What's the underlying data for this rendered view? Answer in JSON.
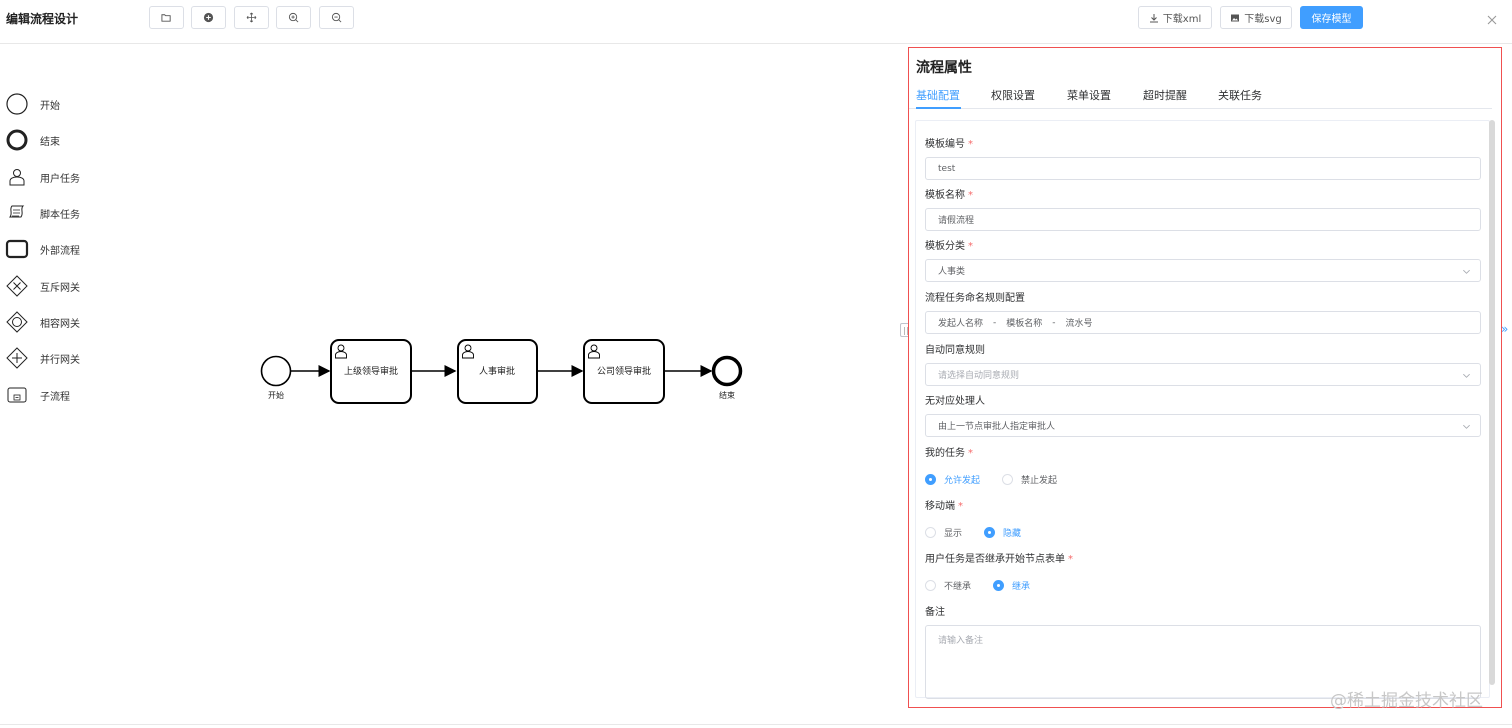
{
  "header": {
    "title": "编辑流程设计",
    "tools": [
      {
        "name": "open-file",
        "icon": "folder-open-icon"
      },
      {
        "name": "add",
        "icon": "plus-circle-icon"
      },
      {
        "name": "move",
        "icon": "move-icon"
      },
      {
        "name": "zoom-in",
        "icon": "zoom-in-icon"
      },
      {
        "name": "zoom-out",
        "icon": "zoom-out-icon"
      }
    ],
    "download_xml_label": "下载xml",
    "download_svg_label": "下载svg",
    "save_label": "保存模型"
  },
  "palette": {
    "items": [
      {
        "label": "开始",
        "icon": "start-event-icon"
      },
      {
        "label": "结束",
        "icon": "end-event-icon"
      },
      {
        "label": "用户任务",
        "icon": "user-task-icon"
      },
      {
        "label": "脚本任务",
        "icon": "script-task-icon"
      },
      {
        "label": "外部流程",
        "icon": "call-activity-icon"
      },
      {
        "label": "互斥网关",
        "icon": "exclusive-gateway-icon"
      },
      {
        "label": "相容网关",
        "icon": "inclusive-gateway-icon"
      },
      {
        "label": "并行网关",
        "icon": "parallel-gateway-icon"
      },
      {
        "label": "子流程",
        "icon": "subprocess-icon"
      }
    ]
  },
  "diagram": {
    "start_label": "开始",
    "end_label": "结束",
    "tasks": [
      {
        "label": "上级领导审批",
        "icon": "user-task-icon"
      },
      {
        "label": "人事审批",
        "icon": "user-task-icon"
      },
      {
        "label": "公司领导审批",
        "icon": "user-task-icon"
      }
    ]
  },
  "panel": {
    "title": "流程属性",
    "tabs": [
      {
        "label": "基础配置",
        "active": true
      },
      {
        "label": "权限设置",
        "active": false
      },
      {
        "label": "菜单设置",
        "active": false
      },
      {
        "label": "超时提醒",
        "active": false
      },
      {
        "label": "关联任务",
        "active": false
      }
    ],
    "form": {
      "template_code": {
        "label": "模板编号",
        "required": "*",
        "value": "test"
      },
      "template_name": {
        "label": "模板名称",
        "required": "*",
        "value": "请假流程"
      },
      "template_category": {
        "label": "模板分类",
        "required": "*",
        "value": "人事类"
      },
      "naming_rule": {
        "label": "流程任务命名规则配置",
        "parts": [
          "发起人名称",
          "-",
          "模板名称",
          "-",
          "流水号"
        ]
      },
      "auto_approve": {
        "label": "自动同意规则",
        "placeholder": "请选择自动同意规则"
      },
      "no_handler": {
        "label": "无对应处理人",
        "value": "由上一节点审批人指定审批人"
      },
      "my_task": {
        "label": "我的任务",
        "required": "*",
        "options": [
          "允许发起",
          "禁止发起"
        ],
        "selected": "允许发起"
      },
      "mobile": {
        "label": "移动端",
        "required": "*",
        "options": [
          "显示",
          "隐藏"
        ],
        "selected": "隐藏"
      },
      "inherit_form": {
        "label": "用户任务是否继承开始节点表单",
        "required": "*",
        "options": [
          "不继承",
          "继承"
        ],
        "selected": "继承"
      },
      "remark": {
        "label": "备注",
        "placeholder": "请输入备注"
      }
    }
  },
  "watermark": "@稀土掘金技术社区",
  "colors": {
    "accent": "#409eff",
    "required": "#f56c6c",
    "panel_border": "#f05050"
  }
}
